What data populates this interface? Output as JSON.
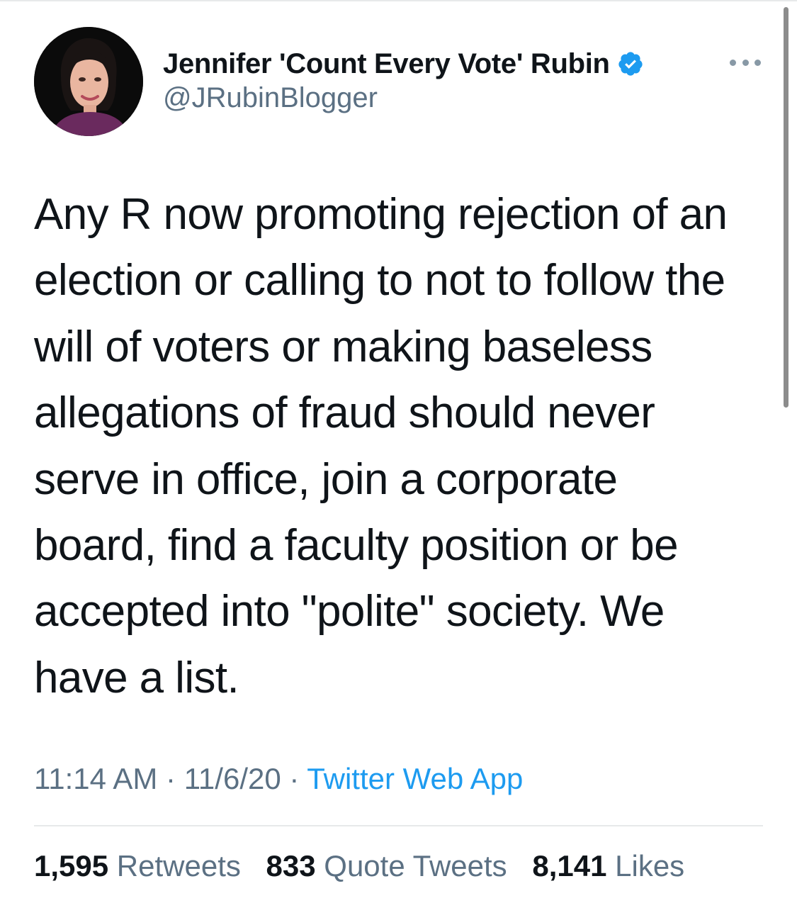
{
  "author": {
    "display_name": "Jennifer 'Count Every Vote' Rubin",
    "handle": "@JRubinBlogger",
    "verified": true,
    "avatar_icon": "profile-photo"
  },
  "tweet": {
    "text_lines": [
      "Any R now promoting rejection of an",
      "election or calling to not to follow the",
      "will of voters or making baseless",
      "allegations of fraud should never",
      "serve in office, join a corporate",
      "board, find a faculty position or be",
      "accepted into \"polite\" society. We",
      "have a list."
    ],
    "time": "11:14 AM",
    "date": "11/6/20",
    "separator": "·",
    "source": "Twitter Web App"
  },
  "stats": {
    "retweets_count": "1,595",
    "retweets_label": "Retweets",
    "quotes_count": "833",
    "quotes_label": "Quote Tweets",
    "likes_count": "8,141",
    "likes_label": "Likes"
  },
  "colors": {
    "accent": "#1d9bf0",
    "secondary_text": "#5b7083",
    "primary_text": "#0f1419"
  }
}
